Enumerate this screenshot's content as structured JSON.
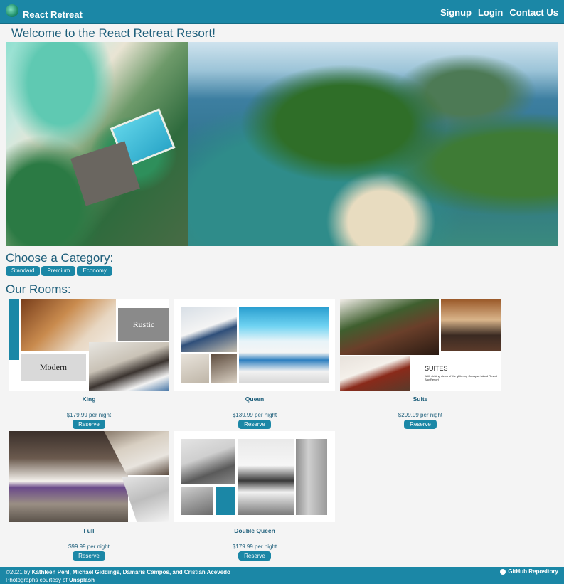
{
  "nav": {
    "brand": "React Retreat",
    "links": [
      "Signup",
      "Login",
      "Contact Us"
    ]
  },
  "welcome": "Welcome to the React Retreat Resort!",
  "categories": {
    "title": "Choose a Category:",
    "buttons": [
      "Standard",
      "Premium",
      "Economy"
    ]
  },
  "rooms": {
    "title": "Our Rooms:",
    "reserve_label": "Reserve",
    "items": [
      {
        "name": "King",
        "price": "$179.99 per night",
        "image_labels": [
          "Rustic",
          "Modern"
        ]
      },
      {
        "name": "Queen",
        "price": "$139.99 per night"
      },
      {
        "name": "Suite",
        "price": "$299.99 per night",
        "image_labels": [
          "SUITES",
          "With striking views of the glittering Cauayan Island Resort Bay Resort"
        ]
      },
      {
        "name": "Full",
        "price": "$99.99 per night"
      },
      {
        "name": "Double Queen",
        "price": "$179.99 per night"
      }
    ]
  },
  "footer": {
    "prefix": "©2021 by ",
    "authors": "Kathleen Pehl, Michael Giddings, Damaris Campos, and Cristian Acevedo",
    "photo_prefix": "Photographs courtesy of ",
    "photo_source": "Unsplash",
    "github": "GitHub Repository"
  },
  "colors": {
    "primary": "#1b87a6",
    "text": "#1d5e7a",
    "background": "#f4f4f4"
  },
  "icons": {
    "logo": "palm-island-logo-icon",
    "github": "github-icon"
  }
}
